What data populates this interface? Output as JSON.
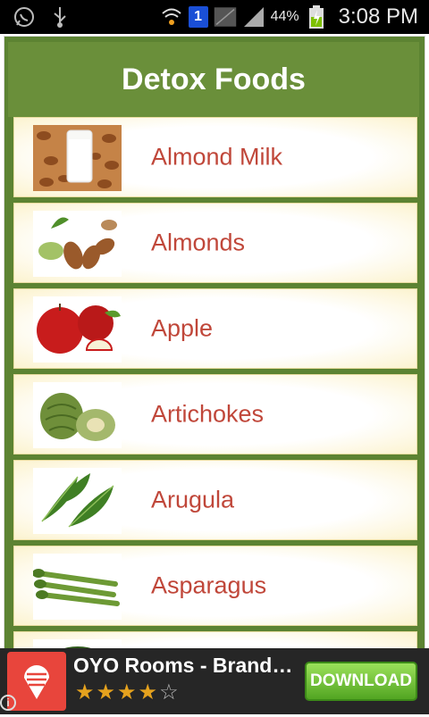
{
  "status_bar": {
    "network_badge": "1",
    "battery_percent": "44%",
    "time": "3:08 PM"
  },
  "header": {
    "title": "Detox Foods"
  },
  "foods": [
    {
      "label": "Almond Milk",
      "icon": "almond-milk-photo"
    },
    {
      "label": "Almonds",
      "icon": "almonds-photo"
    },
    {
      "label": "Apple",
      "icon": "apple-photo"
    },
    {
      "label": "Artichokes",
      "icon": "artichoke-photo"
    },
    {
      "label": "Arugula",
      "icon": "arugula-photo"
    },
    {
      "label": "Asparagus",
      "icon": "asparagus-photo"
    },
    {
      "label": "",
      "icon": "avocado-photo"
    }
  ],
  "ad": {
    "title": "OYO Rooms - Brand…",
    "rating": 4,
    "rating_max": 5,
    "button_label": "DOWNLOAD",
    "info_icon": "i"
  },
  "colors": {
    "header_green": "#6a8f3a",
    "label_red": "#c0473a",
    "download_green": "#52a522"
  }
}
